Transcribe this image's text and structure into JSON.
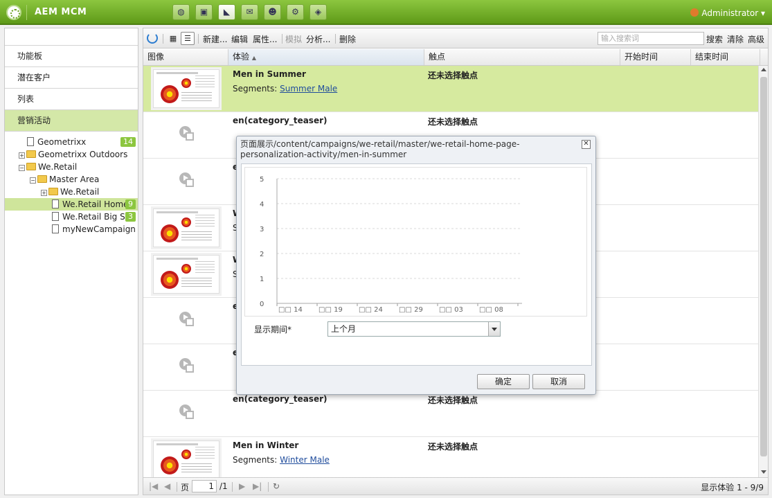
{
  "app": {
    "title": "AEM MCM",
    "user": "Administrator"
  },
  "nav_icons": [
    "globe-icon",
    "camera-icon",
    "megaphone-icon",
    "mail-icon",
    "users-icon",
    "gear-icon",
    "tag-icon"
  ],
  "sidebar": {
    "items": [
      {
        "label": "功能板"
      },
      {
        "label": "潜在客户"
      },
      {
        "label": "列表"
      },
      {
        "label": "营销活动"
      }
    ],
    "tree": [
      {
        "label": "Geometrixx",
        "badge": "14"
      },
      {
        "label": "Geometrixx Outdoors"
      },
      {
        "label": "We.Retail"
      },
      {
        "label": "Master Area"
      },
      {
        "label": "We.Retail"
      },
      {
        "label": "We.Retail Home",
        "badge": "9"
      },
      {
        "label": "We.Retail Big Spe",
        "badge": "3"
      },
      {
        "label": "myNewCampaign"
      }
    ]
  },
  "toolbar": {
    "new": "新建...",
    "edit": "编辑",
    "properties": "属性...",
    "simulate": "模拟",
    "analyze": "分析...",
    "delete": "删除",
    "search_placeholder": "输入搜索词",
    "search": "搜索",
    "clear": "清除",
    "advanced": "高级"
  },
  "columns": {
    "image": "图像",
    "experience": "体验",
    "touchpoint": "触点",
    "start": "开始时间",
    "end": "结束时间"
  },
  "rows": [
    {
      "title": "Men in Summer",
      "seg_label": "Segments:",
      "seg_link": "Summer Male",
      "touch": "还未选择触点",
      "thumb": true
    },
    {
      "title": "en(category_teaser)",
      "touch": "还未选择触点"
    },
    {
      "title": "e"
    },
    {
      "title": "W",
      "sub": "S",
      "thumb": true
    },
    {
      "title": "W",
      "sub": "S",
      "thumb": true
    },
    {
      "title": "e"
    },
    {
      "title": "e"
    },
    {
      "title": "en(category_teaser)",
      "touch": "还未选择触点"
    },
    {
      "title": "Men in Winter",
      "seg_label": "Segments:",
      "seg_link": "Winter Male",
      "touch": "还未选择触点",
      "thumb": true
    }
  ],
  "pager": {
    "page_label": "页",
    "page": "1",
    "of": "/1",
    "status": "显示体验 1 - 9/9"
  },
  "dialog": {
    "title": "页面展示/content/campaigns/we-retail/master/we-retail-home-page-personalization-activity/men-in-summer",
    "period_label": "显示期间*",
    "period_value": "上个月",
    "ok": "确定",
    "cancel": "取消"
  },
  "chart_data": {
    "type": "line",
    "title": "",
    "xlabel": "",
    "ylabel": "",
    "yticks": [
      "0",
      "1",
      "2",
      "3",
      "4",
      "5"
    ],
    "xticks": [
      "□□ 14",
      "□□ 19",
      "□□ 24",
      "□□ 29",
      "□□ 03",
      "□□ 08"
    ],
    "ylim": [
      0,
      5
    ],
    "series": [],
    "grid": true
  },
  "colors": {
    "brand_green": "#8cc63f",
    "selection": "#d6ea9f",
    "link": "#1f4c9c"
  }
}
